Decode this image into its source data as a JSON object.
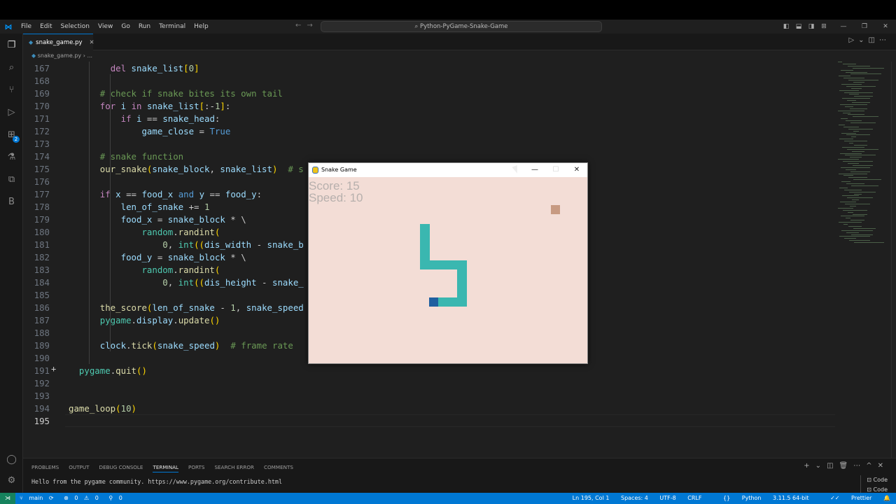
{
  "menu": [
    "File",
    "Edit",
    "Selection",
    "View",
    "Go",
    "Run",
    "Terminal",
    "Help"
  ],
  "command_center": "Python-PyGame-Snake-Game",
  "tab": {
    "label": "snake_game.py"
  },
  "breadcrumb": {
    "file": "snake_game.py",
    "symbol": "..."
  },
  "activity_badge": "2",
  "code_lines": [
    {
      "n": "167",
      "html": "        <span class='k'>del</span> <span class='v'>snake_list</span><span class='p'>[</span><span class='n'>0</span><span class='p'>]</span>"
    },
    {
      "n": "168",
      "html": ""
    },
    {
      "n": "169",
      "html": "      <span class='c'># check if snake bites its own tail</span>"
    },
    {
      "n": "170",
      "html": "      <span class='k'>for</span> <span class='v'>i</span> <span class='k'>in</span> <span class='v'>snake_list</span><span class='p'>[</span>:-<span class='n'>1</span><span class='p'>]</span>:"
    },
    {
      "n": "171",
      "html": "          <span class='k'>if</span> <span class='v'>i</span> == <span class='v'>snake_head</span>:"
    },
    {
      "n": "172",
      "html": "              <span class='v'>game_close</span> = <span class='kb'>True</span>"
    },
    {
      "n": "173",
      "html": ""
    },
    {
      "n": "174",
      "html": "      <span class='c'># snake function</span>"
    },
    {
      "n": "175",
      "html": "      <span class='f'>our_snake</span><span class='p'>(</span><span class='v'>snake_block</span>, <span class='v'>snake_list</span><span class='p'>)</span>  <span class='c'># s</span>"
    },
    {
      "n": "176",
      "html": ""
    },
    {
      "n": "177",
      "html": "      <span class='k'>if</span> <span class='v'>x</span> == <span class='v'>food_x</span> <span class='kb'>and</span> <span class='v'>y</span> == <span class='v'>food_y</span>:"
    },
    {
      "n": "178",
      "html": "          <span class='v'>len_of_snake</span> += <span class='n'>1</span>"
    },
    {
      "n": "179",
      "html": "          <span class='v'>food_x</span> = <span class='v'>snake_block</span> * \\"
    },
    {
      "n": "180",
      "html": "              <span class='t'>random</span>.<span class='f'>randint</span><span class='p'>(</span>"
    },
    {
      "n": "181",
      "html": "                  <span class='n'>0</span>, <span class='t'>int</span><span class='p'>((</span><span class='v'>dis_width</span> - <span class='v'>snake_b</span>"
    },
    {
      "n": "182",
      "html": "          <span class='v'>food_y</span> = <span class='v'>snake_block</span> * \\"
    },
    {
      "n": "183",
      "html": "              <span class='t'>random</span>.<span class='f'>randint</span><span class='p'>(</span>"
    },
    {
      "n": "184",
      "html": "                  <span class='n'>0</span>, <span class='t'>int</span><span class='p'>((</span><span class='v'>dis_height</span> - <span class='v'>snake_</span>"
    },
    {
      "n": "185",
      "html": ""
    },
    {
      "n": "186",
      "html": "      <span class='f'>the_score</span><span class='p'>(</span><span class='v'>len_of_snake</span> - <span class='n'>1</span>, <span class='v'>snake_speed</span>"
    },
    {
      "n": "187",
      "html": "      <span class='t'>pygame</span>.<span class='v'>display</span>.<span class='f'>update</span><span class='p'>()</span>"
    },
    {
      "n": "188",
      "html": ""
    },
    {
      "n": "189",
      "html": "      <span class='v'>clock</span>.<span class='f'>tick</span><span class='p'>(</span><span class='v'>snake_speed</span><span class='p'>)</span>  <span class='c'># frame rate</span>"
    },
    {
      "n": "190",
      "html": ""
    },
    {
      "n": "191",
      "html": "  <span class='t'>pygame</span>.<span class='f'>quit</span><span class='p'>()</span>"
    },
    {
      "n": "192",
      "html": ""
    },
    {
      "n": "193",
      "html": ""
    },
    {
      "n": "194",
      "html": "<span class='f'>game_loop</span><span class='p'>(</span><span class='n'>10</span><span class='p'>)</span>"
    },
    {
      "n": "195",
      "html": ""
    }
  ],
  "panel": {
    "tabs": [
      "PROBLEMS",
      "OUTPUT",
      "DEBUG CONSOLE",
      "TERMINAL",
      "PORTS",
      "SEARCH ERROR",
      "COMMENTS"
    ],
    "active_tab": "TERMINAL",
    "terminal_text": "Hello from the pygame community. https://www.pygame.org/contribute.html",
    "terminals": [
      "Code",
      "Code"
    ]
  },
  "statusbar": {
    "branch": "main",
    "errors": "0",
    "warnings": "0",
    "ports": "0",
    "position": "Ln 195, Col 1",
    "spaces": "Spaces: 4",
    "encoding": "UTF-8",
    "eol": "CRLF",
    "language": "Python",
    "interpreter": "3.11.5 64-bit",
    "formatter": "Prettier"
  },
  "game": {
    "title": "Snake Game",
    "score": "Score: 15",
    "speed": "Speed: 10",
    "colors": {
      "background": "#f3ddd6",
      "snake": "#3ab7b0",
      "head": "#1f5fa0",
      "food": "#c79a82"
    }
  }
}
